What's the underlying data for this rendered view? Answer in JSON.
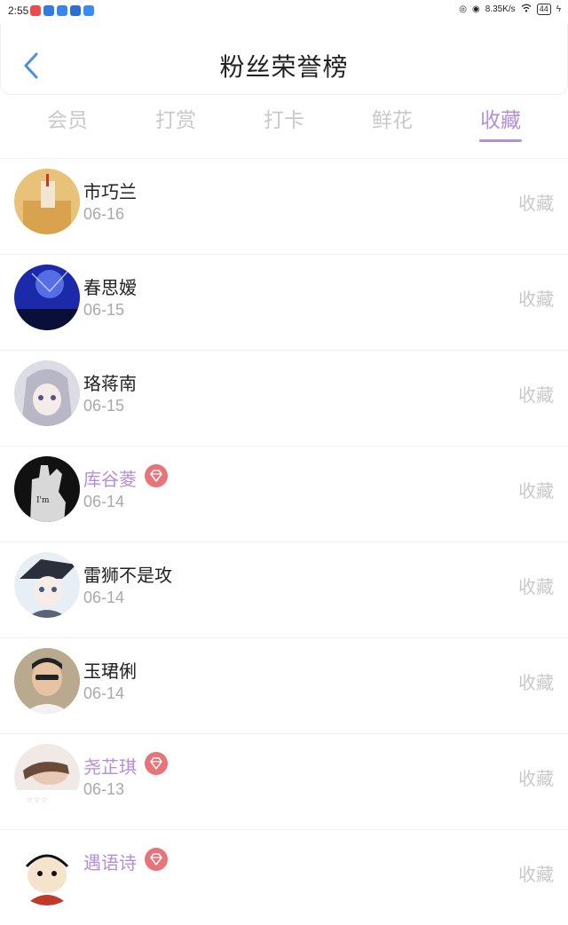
{
  "status_bar": {
    "time": "2:55",
    "speed": "8.35K/s",
    "battery": "44"
  },
  "header": {
    "title": "粉丝荣誉榜"
  },
  "tabs": [
    {
      "label": "会员"
    },
    {
      "label": "打赏"
    },
    {
      "label": "打卡"
    },
    {
      "label": "鲜花"
    },
    {
      "label": "收藏",
      "active": true
    }
  ],
  "fans": [
    {
      "name": "市巧兰",
      "date": "06-16",
      "action": "收藏",
      "vip": false
    },
    {
      "name": "春思嫒",
      "date": "06-15",
      "action": "收藏",
      "vip": false
    },
    {
      "name": "珞蒋南",
      "date": "06-15",
      "action": "收藏",
      "vip": false
    },
    {
      "name": "库谷菱",
      "date": "06-14",
      "action": "收藏",
      "vip": true
    },
    {
      "name": "雷狮不是攻",
      "date": "06-14",
      "action": "收藏",
      "vip": false
    },
    {
      "name": "玉珺俐",
      "date": "06-14",
      "action": "收藏",
      "vip": false
    },
    {
      "name": "尧芷琪",
      "date": "06-13",
      "action": "收藏",
      "vip": true
    },
    {
      "name": "遇语诗",
      "date": "",
      "action": "收藏",
      "vip": true
    }
  ],
  "colors": {
    "accent": "#b48ed9",
    "vip_badge": "#e8747a",
    "muted": "#c9c9c9",
    "back_arrow": "#4a90e2"
  }
}
